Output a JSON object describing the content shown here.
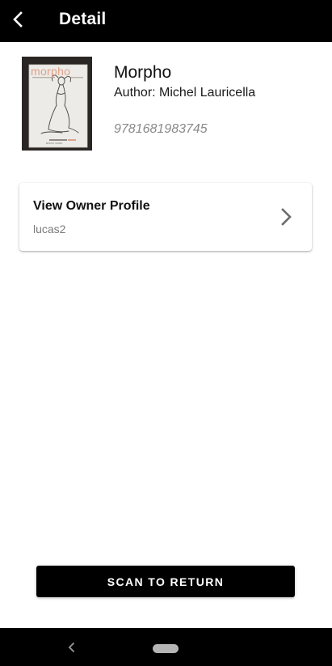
{
  "app_bar": {
    "title": "Detail",
    "back_icon": "arrow-back-icon"
  },
  "book": {
    "title": "Morpho",
    "author": "Author: Michel Lauricella",
    "isbn": "9781681983745",
    "cover": {
      "title_text": "morpho",
      "publisher_text": "ROCKY NOOK"
    }
  },
  "owner_card": {
    "title": "View Owner Profile",
    "username": "lucas2",
    "chevron_icon": "chevron-right-icon"
  },
  "actions": {
    "scan_label": "SCAN TO RETURN"
  },
  "system_nav": {
    "back_icon": "nav-back-icon",
    "home_icon": "nav-home-pill-icon"
  },
  "colors": {
    "app_bar_bg": "#000000",
    "button_bg": "#000000",
    "accent_cover_title": "#e0a08a"
  }
}
